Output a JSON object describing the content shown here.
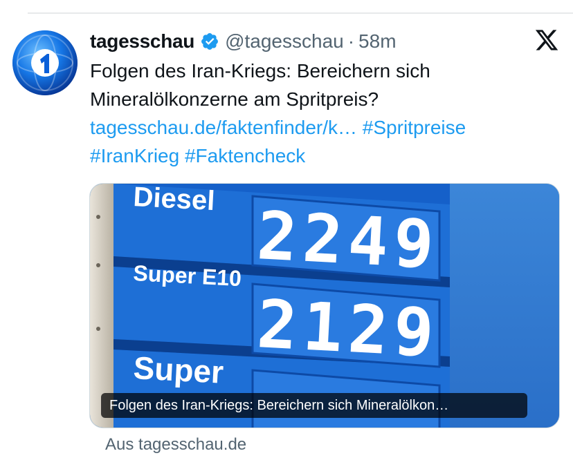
{
  "tweet": {
    "display_name": "tagesschau",
    "handle": "@tagesschau",
    "separator": "·",
    "time": "58m",
    "text_line1": "Folgen des Iran-Kriegs: Bereichern sich",
    "text_line2": "Mineralölkonzerne am Spritpreis?",
    "link_url": "tagesschau.de/faktenfinder/k…",
    "hashtag_1": "#Spritpreise",
    "hashtag_2": "#IranKrieg",
    "hashtag_3": "#Faktencheck"
  },
  "card": {
    "caption": "Folgen des Iran-Kriegs: Bereichern sich Mineralölkon…",
    "source": "Aus tagesschau.de"
  },
  "image_signs": {
    "row1_label": "Diesel",
    "row1_price": "2249",
    "row2_label": "Super E10",
    "row2_price": "2129",
    "row3_label": "Super"
  },
  "icons": {
    "avatar": "tagesschau-logo-icon",
    "verified": "verified-badge-icon",
    "platform": "x-logo-icon"
  },
  "colors": {
    "link": "#1d9bf0",
    "verified": "#1d9bf0",
    "secondary_text": "#536471",
    "sky": "#2c7ad2"
  }
}
